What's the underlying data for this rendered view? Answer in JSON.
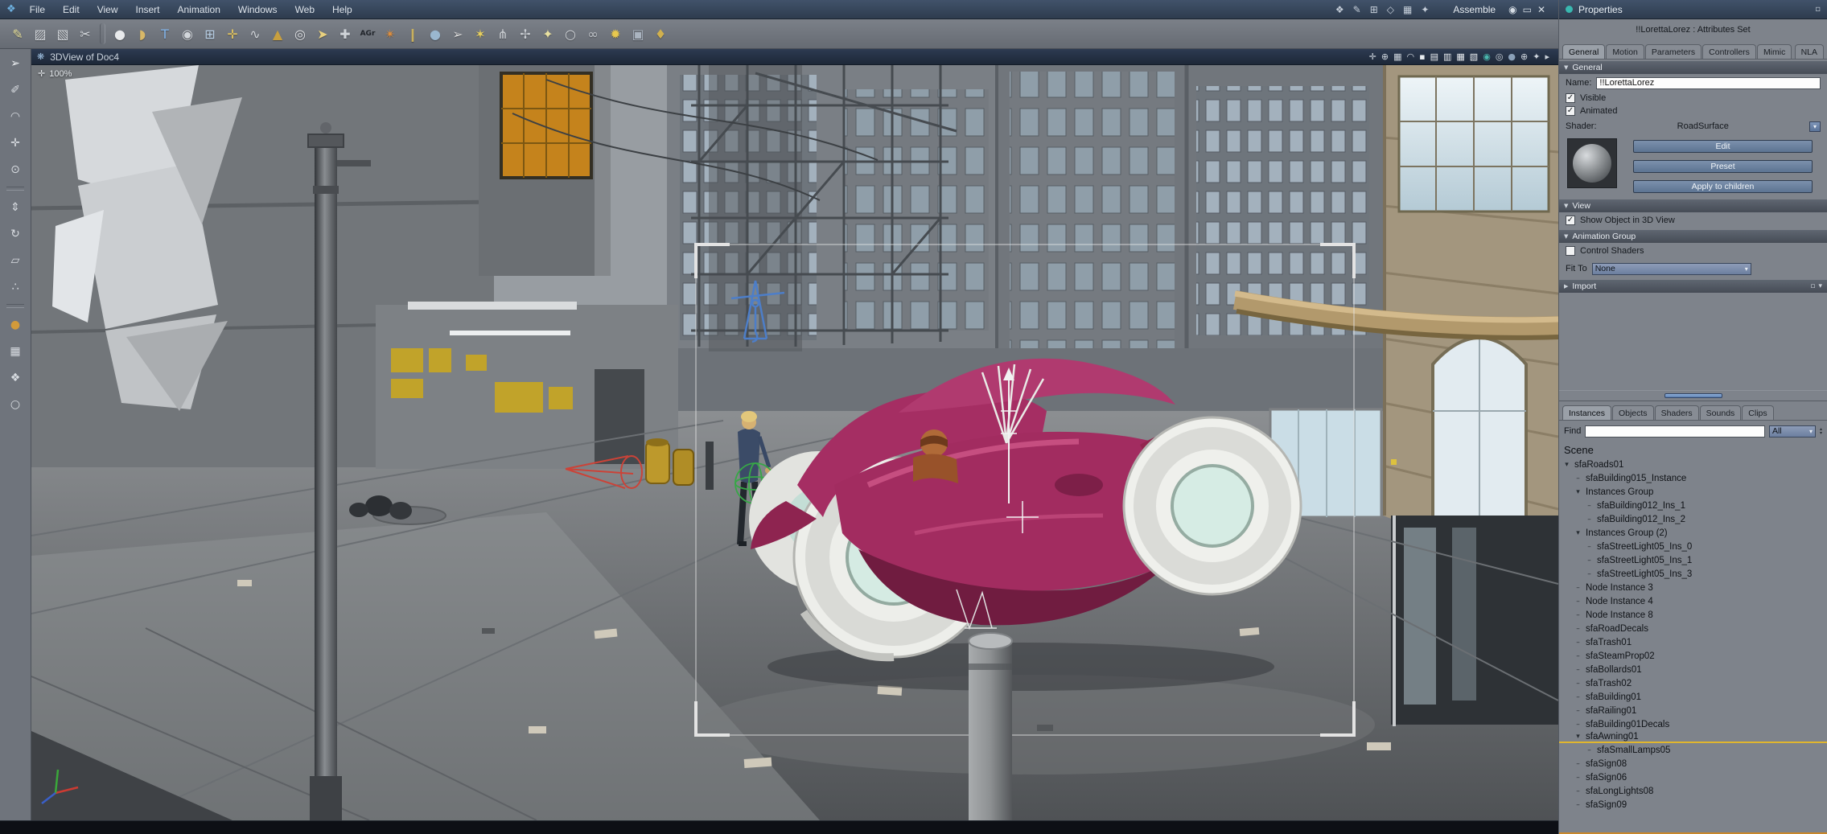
{
  "menubar": {
    "logo_glyph": "❖",
    "menus": [
      {
        "name": "menu-file",
        "label": "File"
      },
      {
        "name": "menu-edit",
        "label": "Edit"
      },
      {
        "name": "menu-view",
        "label": "View"
      },
      {
        "name": "menu-insert",
        "label": "Insert"
      },
      {
        "name": "menu-animation",
        "label": "Animation"
      },
      {
        "name": "menu-windows",
        "label": "Windows"
      },
      {
        "name": "menu-web",
        "label": "Web"
      },
      {
        "name": "menu-help",
        "label": "Help"
      }
    ],
    "right_icons": [
      {
        "name": "hand-tool-icon",
        "glyph": "❖"
      },
      {
        "name": "pen-tool-icon",
        "glyph": "✎"
      },
      {
        "name": "widget-tool-icon",
        "glyph": "⊞"
      },
      {
        "name": "link-tool-icon",
        "glyph": "◇"
      },
      {
        "name": "panel-tool-icon",
        "glyph": "▦"
      },
      {
        "name": "script-tool-icon",
        "glyph": "✦"
      }
    ],
    "mode_label": "Assemble",
    "window_icons": [
      {
        "name": "eye-icon",
        "glyph": "◉"
      },
      {
        "name": "maximize-icon",
        "glyph": "▭"
      },
      {
        "name": "close-icon",
        "glyph": "✕"
      }
    ]
  },
  "toolbar": {
    "icons": [
      {
        "name": "paint-tool-icon",
        "glyph": "✎",
        "color": "#e6df9b"
      },
      {
        "name": "fill-tool-icon",
        "glyph": "▨",
        "color": "#d2d6db"
      },
      {
        "name": "erase-tool-icon",
        "glyph": "▧",
        "color": "#d2d6db"
      },
      {
        "name": "cut-tool-icon",
        "glyph": "✂",
        "color": "#d8dce1"
      },
      {
        "cls": "sep"
      },
      {
        "name": "sphere-primitive-icon",
        "glyph": "●",
        "color": "#e8eaec"
      },
      {
        "name": "capsule-primitive-icon",
        "glyph": "◗",
        "color": "#d8b868"
      },
      {
        "name": "text-primitive-icon",
        "glyph": "T",
        "color": "#82b4e8"
      },
      {
        "name": "geosphere-primitive-icon",
        "glyph": "◉",
        "color": "#d2d6db"
      },
      {
        "name": "lattice-tool-icon",
        "glyph": "⊞",
        "color": "#b9d0e6"
      },
      {
        "name": "axes-tool-icon",
        "glyph": "✛",
        "color": "#e6c75f"
      },
      {
        "name": "spring-primitive-icon",
        "glyph": "∿",
        "color": "#d2d6db"
      },
      {
        "name": "cone-primitive-icon",
        "glyph": "▲",
        "color": "#c89f3e"
      },
      {
        "name": "torus-primitive-icon",
        "glyph": "◎",
        "color": "#e0e2e5"
      },
      {
        "name": "arrow-tool-icon",
        "glyph": "➤",
        "color": "#e8d07e"
      },
      {
        "name": "anchor-tool-icon",
        "glyph": "✚",
        "color": "#cfd3d8"
      },
      {
        "name": "agr-tool-icon",
        "glyph": "AGr",
        "color": "#20242a",
        "cls": "txt"
      },
      {
        "name": "flame-tool-icon",
        "glyph": "✴",
        "color": "#df8f3f"
      },
      {
        "name": "pin-tool-icon",
        "glyph": "❙",
        "color": "#c8b05e"
      },
      {
        "name": "orb-tool-icon",
        "glyph": "●",
        "color": "#9ab7cf"
      },
      {
        "name": "dart-tool-icon",
        "glyph": "➢",
        "color": "#d8d8d8"
      },
      {
        "name": "star-tool-icon",
        "glyph": "✶",
        "color": "#e8d05e"
      },
      {
        "name": "rig-tool-icon",
        "glyph": "⋔",
        "color": "#d0d4d8"
      },
      {
        "name": "gear-tool-icon",
        "glyph": "✢",
        "color": "#c8ccd1"
      },
      {
        "name": "wand-tool-icon",
        "glyph": "✦",
        "color": "#e8e0a0"
      },
      {
        "name": "ring-tool-icon",
        "glyph": "○",
        "color": "#d0d4d8"
      },
      {
        "name": "helix-tool-icon",
        "glyph": "∞",
        "color": "#c0c4c9"
      },
      {
        "name": "light-tool-icon",
        "glyph": "✹",
        "color": "#e8c84e"
      },
      {
        "name": "camera-tool-icon",
        "glyph": "▣",
        "color": "#aab4c0"
      },
      {
        "name": "key-tool-icon",
        "glyph": "♦",
        "color": "#d0b04e"
      }
    ]
  },
  "left_toolbar": {
    "icons": [
      {
        "name": "select-tool-icon",
        "glyph": "➢",
        "color": "#eef1f4"
      },
      {
        "name": "paint-select-icon",
        "glyph": "✐",
        "color": "#d8dce1"
      },
      {
        "name": "orbit-view-icon",
        "glyph": "◠",
        "color": "#d8dce1"
      },
      {
        "name": "pan-view-icon",
        "glyph": "✛",
        "color": "#d8dce1"
      },
      {
        "name": "zoom-view-icon",
        "glyph": "⊙",
        "color": "#d8dce1"
      },
      {
        "cls": "sep"
      },
      {
        "name": "move-object-icon",
        "glyph": "⇕",
        "color": "#d8dce1"
      },
      {
        "name": "rotate-object-icon",
        "glyph": "↻",
        "color": "#d8dce1"
      },
      {
        "name": "scale-object-icon",
        "glyph": "▱",
        "color": "#d8dce1"
      },
      {
        "name": "snap-tool-icon",
        "glyph": "∴",
        "color": "#d8dce1"
      },
      {
        "cls": "sep"
      },
      {
        "name": "material-sphere-icon",
        "glyph": "●",
        "color": "#d29a3a"
      },
      {
        "name": "render-view-icon",
        "glyph": "▦",
        "color": "#d8dce1"
      },
      {
        "name": "hand-view-icon",
        "glyph": "❖",
        "color": "#d8dce1"
      },
      {
        "name": "magnify-view-icon",
        "glyph": "○",
        "color": "#d8dce1"
      }
    ]
  },
  "viewport": {
    "title_icon": "❋",
    "title": "3DView of Doc4",
    "zoom_icon": "✛",
    "zoom_label": "100%",
    "header_icons": [
      {
        "name": "snap-toggle-icon",
        "glyph": "✛"
      },
      {
        "name": "axis-toggle-icon",
        "glyph": "⊕"
      },
      {
        "name": "grid-toggle-icon",
        "glyph": "▦"
      },
      {
        "name": "camera-view-icon",
        "glyph": "◠"
      },
      {
        "name": "layout-single-icon",
        "glyph": "▪",
        "cls": "sq"
      },
      {
        "name": "layout-two-icon",
        "glyph": "▤",
        "cls": "sq"
      },
      {
        "name": "layout-three-icon",
        "glyph": "▥",
        "cls": "sq"
      },
      {
        "name": "layout-four-icon",
        "glyph": "▦",
        "cls": "sq"
      },
      {
        "name": "layout-custom-icon",
        "glyph": "▧",
        "cls": "sq"
      },
      {
        "name": "shade-mode-icon",
        "glyph": "◉",
        "color": "#4ab8ae"
      },
      {
        "name": "wire-mode-icon",
        "glyph": "◎"
      },
      {
        "name": "texture-mode-icon",
        "glyph": "●",
        "color": "#8aa0b8"
      },
      {
        "name": "world-axis-icon",
        "glyph": "⊕"
      },
      {
        "name": "bookmark-icon",
        "glyph": "✦"
      },
      {
        "name": "expand-icon",
        "glyph": "▸"
      }
    ]
  },
  "properties": {
    "title": "Properties",
    "header_icon": "▫",
    "subtitle": "!!LorettaLorez : Attributes Set",
    "icons": {
      "collapse": "▼",
      "expand": "▶",
      "dropdown": "▾",
      "check": "✓",
      "spin_up": "▴",
      "spin_down": "▾"
    },
    "tabs": [
      {
        "name": "tab-general",
        "label": "General",
        "active": true
      },
      {
        "name": "tab-motion",
        "label": "Motion"
      },
      {
        "name": "tab-parameters",
        "label": "Parameters"
      },
      {
        "name": "tab-controllers",
        "label": "Controllers"
      },
      {
        "name": "tab-mimic",
        "label": "Mimic"
      },
      {
        "name": "tab-nla",
        "label": "NLA",
        "cls": "last"
      }
    ],
    "sections": {
      "general": "General",
      "view": "View",
      "animation_group": "Animation Group",
      "import": "Import"
    },
    "fields": {
      "name_label": "Name:",
      "name_value": "!!LorettaLorez",
      "visible": "Visible",
      "animated": "Animated",
      "shader_label": "Shader:",
      "shader_value": "RoadSurface",
      "show_object": "Show Object in 3D View",
      "control_shaders": "Control Shaders",
      "fit_to_label": "Fit To",
      "fit_to_value": "None"
    },
    "buttons": [
      {
        "name": "edit-button",
        "label": "Edit"
      },
      {
        "name": "preset-button",
        "label": "Preset"
      },
      {
        "name": "apply-to-children-button",
        "label": "Apply to children"
      }
    ],
    "import_icons": [
      {
        "name": "import-add-icon",
        "glyph": "▫"
      },
      {
        "name": "import-menu-icon",
        "glyph": "▾"
      }
    ],
    "browser_tabs": [
      {
        "name": "tab-instances",
        "label": "Instances",
        "active": true
      },
      {
        "name": "tab-objects",
        "label": "Objects"
      },
      {
        "name": "tab-shaders",
        "label": "Shaders"
      },
      {
        "name": "tab-sounds",
        "label": "Sounds"
      },
      {
        "name": "tab-clips",
        "label": "Clips"
      }
    ],
    "find_label": "Find",
    "filter_value": "All",
    "tree_root": "Scene",
    "tree": [
      {
        "label": "sfaRoads01",
        "depth": 0,
        "tw": "▾"
      },
      {
        "label": "sfaBuilding015_Instance",
        "depth": 1,
        "tw": "–"
      },
      {
        "label": "Instances Group",
        "depth": 1,
        "tw": "▾"
      },
      {
        "label": "sfaBuilding012_Ins_1",
        "depth": 2,
        "tw": "–"
      },
      {
        "label": "sfaBuilding012_Ins_2",
        "depth": 2,
        "tw": "–"
      },
      {
        "label": "Instances Group (2)",
        "depth": 1,
        "tw": "▾"
      },
      {
        "label": "sfaStreetLight05_Ins_0",
        "depth": 2,
        "tw": "–"
      },
      {
        "label": "sfaStreetLight05_Ins_1",
        "depth": 2,
        "tw": "–"
      },
      {
        "label": "sfaStreetLight05_Ins_3",
        "depth": 2,
        "tw": "–"
      },
      {
        "label": "Node Instance 3",
        "depth": 1,
        "tw": "–"
      },
      {
        "label": "Node Instance 4",
        "depth": 1,
        "tw": "–"
      },
      {
        "label": "Node Instance 8",
        "depth": 1,
        "tw": "–"
      },
      {
        "label": "sfaRoadDecals",
        "depth": 1,
        "tw": "–"
      },
      {
        "label": "sfaTrash01",
        "depth": 1,
        "tw": "–"
      },
      {
        "label": "sfaSteamProp02",
        "depth": 1,
        "tw": "–"
      },
      {
        "label": "sfaBollards01",
        "depth": 1,
        "tw": "–"
      },
      {
        "label": "sfaTrash02",
        "depth": 1,
        "tw": "–"
      },
      {
        "label": "sfaBuilding01",
        "depth": 1,
        "tw": "–"
      },
      {
        "label": "sfaRailing01",
        "depth": 1,
        "tw": "–"
      },
      {
        "label": "sfaBuilding01Decals",
        "depth": 1,
        "tw": "–"
      },
      {
        "label": "sfaAwning01",
        "depth": 1,
        "tw": "▾",
        "highlight": true
      },
      {
        "label": "sfaSmallLamps05",
        "depth": 2,
        "tw": "–"
      },
      {
        "label": "sfaSign08",
        "depth": 1,
        "tw": "–"
      },
      {
        "label": "sfaSign06",
        "depth": 1,
        "tw": "–"
      },
      {
        "label": "sfaLongLights08",
        "depth": 1,
        "tw": "–"
      },
      {
        "label": "sfaSign09",
        "depth": 1,
        "tw": "–"
      }
    ]
  }
}
